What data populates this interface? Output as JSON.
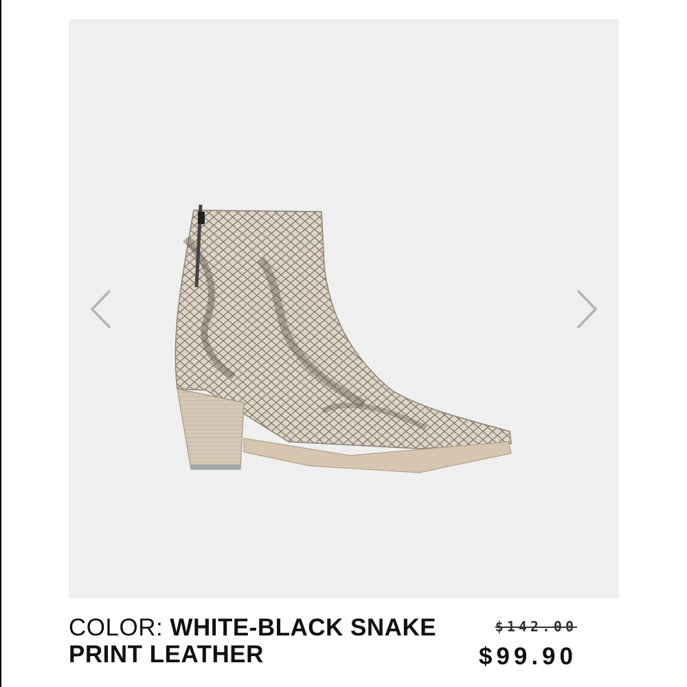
{
  "product": {
    "image_name": "white-black snake print leather ankle boot",
    "color_label": "COLOR: ",
    "color_value": "WHITE-BLACK SNAKE PRINT LEATHER",
    "original_price": "$142.00",
    "sale_price": "$99.90"
  },
  "gallery": {
    "prev_icon": "chevron-left-icon",
    "next_icon": "chevron-right-icon"
  },
  "colors": {
    "background": "#efefef",
    "arrow": "#b3b3b3",
    "text": "#111111"
  }
}
